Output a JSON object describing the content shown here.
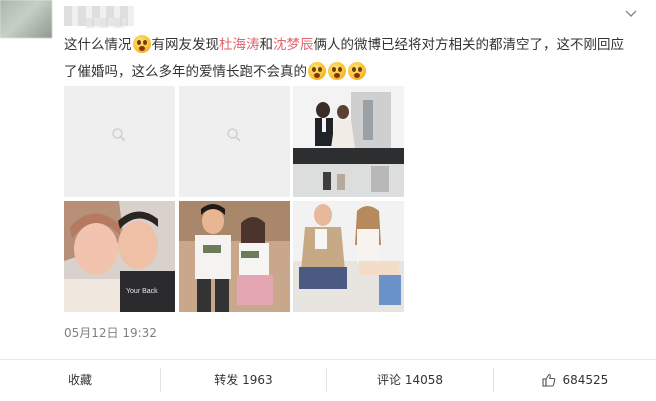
{
  "post": {
    "text_part1": "这什么情况",
    "text_part2": "有网友发现",
    "name1": "杜海涛",
    "text_part3": "和",
    "name2": "沈梦辰",
    "text_part4": "俩人的微博已经将对方相关的都清空了，这不刚回应了催婚吗，这么多年的爱情长跑不会真的",
    "timestamp": "05月12日 19:32"
  },
  "emoji": {
    "icon": "shocked-face-emoji",
    "color": "#f7c030"
  },
  "highlight_color": "#e3646d",
  "images": [
    {
      "type": "placeholder",
      "icon": "picture-icon"
    },
    {
      "type": "placeholder",
      "icon": "picture-icon"
    },
    {
      "type": "photo",
      "subject": "wedding-scene"
    },
    {
      "type": "photo",
      "subject": "couple-selfie"
    },
    {
      "type": "photo",
      "subject": "couple-street"
    },
    {
      "type": "photo",
      "subject": "couple-sofa"
    }
  ],
  "actions": {
    "favorite_label": "收藏",
    "repost_label": "转发",
    "repost_count": "1963",
    "comment_label": "评论",
    "comment_count": "14058",
    "like_count": "684525"
  }
}
